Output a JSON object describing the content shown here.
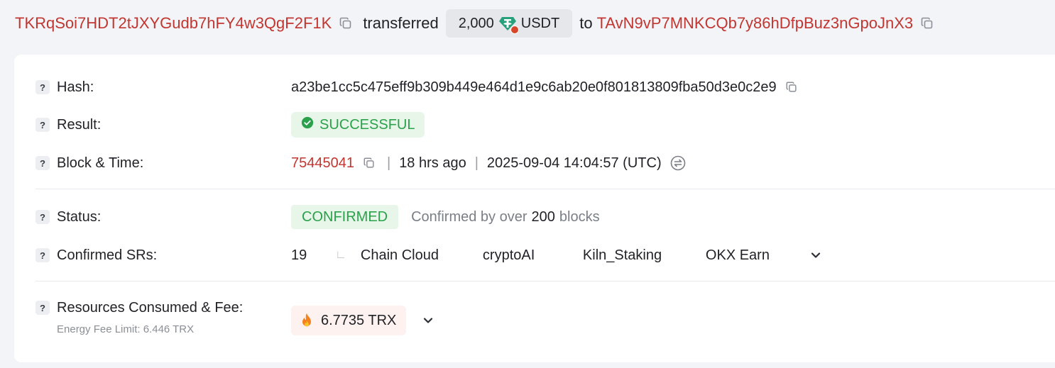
{
  "header": {
    "from_address": "TKRqSoi7HDT2tJXYGudb7hFY4w3QgF2F1K",
    "transferred_word": "transferred",
    "amount": "2,000",
    "token": "USDT",
    "to_word": "to",
    "to_address": "TAvN9vP7MNKCQb7y86hDfpBuz3nGpoJnX3"
  },
  "fields": {
    "hash_label": "Hash:",
    "hash_value": "a23be1cc5c475eff9b309b449e464d1e9c6ab20e0f801813809fba50d3e0c2e9",
    "result_label": "Result:",
    "result_value": "SUCCESSFUL",
    "block_time_label": "Block & Time:",
    "block_number": "75445041",
    "relative_time": "18 hrs ago",
    "timestamp": "2025-09-04 14:04:57 (UTC)",
    "status_label": "Status:",
    "status_value": "CONFIRMED",
    "confirmed_by_prefix": "Confirmed by over",
    "confirmed_by_count": "200",
    "confirmed_by_suffix": "blocks",
    "srs_label": "Confirmed SRs:",
    "srs_count": "19",
    "srs_tree_glyph": "∟",
    "srs": [
      "Chain Cloud",
      "cryptoAI",
      "Kiln_Staking",
      "OKX Earn"
    ],
    "resources_label": "Resources Consumed & Fee:",
    "energy_fee_limit": "Energy Fee Limit: 6.446 TRX",
    "fee_value": "6.7735 TRX"
  },
  "help_glyph": "?",
  "colors": {
    "address_red": "#c23631",
    "success_green": "#2aa14a",
    "success_bg": "#e8f6ea",
    "fee_bg": "#fdf2ef",
    "tether_green": "#26a17b"
  },
  "icons": [
    "copy-icon",
    "usdt-icon",
    "check-circle-icon",
    "swap-icon",
    "chevron-down-icon",
    "fire-icon",
    "help-icon"
  ]
}
